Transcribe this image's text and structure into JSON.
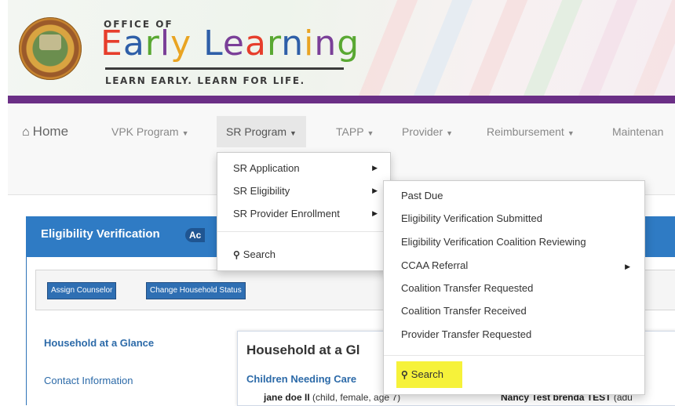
{
  "brand": {
    "top": "OFFICE OF",
    "main_letters": [
      "E",
      "a",
      "r",
      "l",
      "y",
      " ",
      "L",
      "e",
      "a",
      "r",
      "n",
      "i",
      "n",
      "g"
    ],
    "tagline": "LEARN EARLY. LEARN FOR LIFE."
  },
  "nav": {
    "home": "Home",
    "items": [
      "VPK Program",
      "SR Program",
      "TAPP",
      "Provider",
      "Reimbursement",
      "Maintenan"
    ]
  },
  "menu_sr": {
    "items": [
      "SR Application",
      "SR Eligibility",
      "SR Provider Enrollment"
    ],
    "search": "Search"
  },
  "menu_elig": {
    "items": [
      "Past Due",
      "Eligibility Verification Submitted",
      "Eligibility Verification Coalition Reviewing",
      "CCAA Referral",
      "Coalition Transfer Requested",
      "Coalition Transfer Received",
      "Provider Transfer Requested"
    ],
    "search": "Search"
  },
  "panel": {
    "title": "Eligibility Verification",
    "badge": "Ac",
    "buttons": [
      "Assign Counselor",
      "Change Household Status"
    ],
    "side_links": [
      "Household at a Glance",
      "Contact Information"
    ]
  },
  "card": {
    "title": "Household at a Gl",
    "sub": "Children Needing Care",
    "child1_name": "jane doe II",
    "child1_info": "(child, female, age 7)",
    "child2_name": "Nancy Test brenda TEST",
    "child2_info": "(adu"
  },
  "colors": {
    "purple": "#6b2f86",
    "panel_blue": "#2f7bc4",
    "highlight": "#f6f23a"
  }
}
